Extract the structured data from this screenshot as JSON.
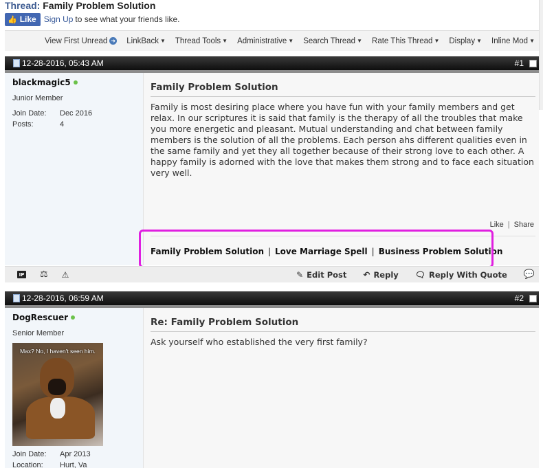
{
  "thread": {
    "label": "Thread:",
    "title": "Family Problem Solution"
  },
  "facebook": {
    "like_label": "Like",
    "signup_link": "Sign Up",
    "signup_rest": "to see what your friends like."
  },
  "toolbar": {
    "items": [
      {
        "label": "View First Unread"
      },
      {
        "label": "LinkBack"
      },
      {
        "label": "Thread Tools"
      },
      {
        "label": "Administrative"
      },
      {
        "label": "Search Thread"
      },
      {
        "label": "Rate This Thread"
      },
      {
        "label": "Display"
      },
      {
        "label": "Inline Mod"
      }
    ]
  },
  "posts": [
    {
      "date": "12-28-2016, 05:43 AM",
      "number": "#1",
      "username": "blackmagic5",
      "usertitle": "Junior Member",
      "info": [
        {
          "key": "Join Date:",
          "value": "Dec 2016"
        },
        {
          "key": "Posts:",
          "value": "4"
        }
      ],
      "title": "Family Problem Solution",
      "body": "Family is most desiring place where you have fun with your family members and get relax. In our scriptures it is said that family is the therapy of all the troubles that make you more energetic and pleasant. Mutual understanding and chat between family members is the solution of all the problems. Each person ahs different qualities even in the same family and yet they all together because of their strong love to each other. A happy family is adorned with the love that makes them strong and to face each situation very well.",
      "like": "Like",
      "like_share_sep": "|",
      "share": "Share",
      "signature": {
        "links": [
          "Family Problem Solution",
          "Love Marriage Spell",
          "Business Problem Solution"
        ],
        "separator": "|"
      },
      "actions": {
        "ip_icon_text": "IP",
        "edit": "Edit Post",
        "reply": "Reply",
        "quote": "Reply With Quote"
      }
    },
    {
      "date": "12-28-2016, 06:59 AM",
      "number": "#2",
      "username": "DogRescuer",
      "usertitle": "Senior Member",
      "avatar_caption": "Max? No, I haven't seen him.",
      "info": [
        {
          "key": "Join Date:",
          "value": "Apr 2013"
        },
        {
          "key": "Location:",
          "value": "Hurt, Va"
        }
      ],
      "title": "Re: Family Problem Solution",
      "body": "Ask yourself who established the very first family?"
    }
  ],
  "colors": {
    "highlight": "#e01fe0",
    "fb_blue": "#4267b2",
    "online": "#6cc24a"
  },
  "icons": {
    "ip": "ip-icon",
    "scales": "scales-icon",
    "warning": "warning-icon",
    "edit": "pencil-icon",
    "reply": "reply-arrow-icon",
    "quote": "quote-bubble-icon",
    "multiquote": "multiquote-icon",
    "document": "document-icon"
  }
}
